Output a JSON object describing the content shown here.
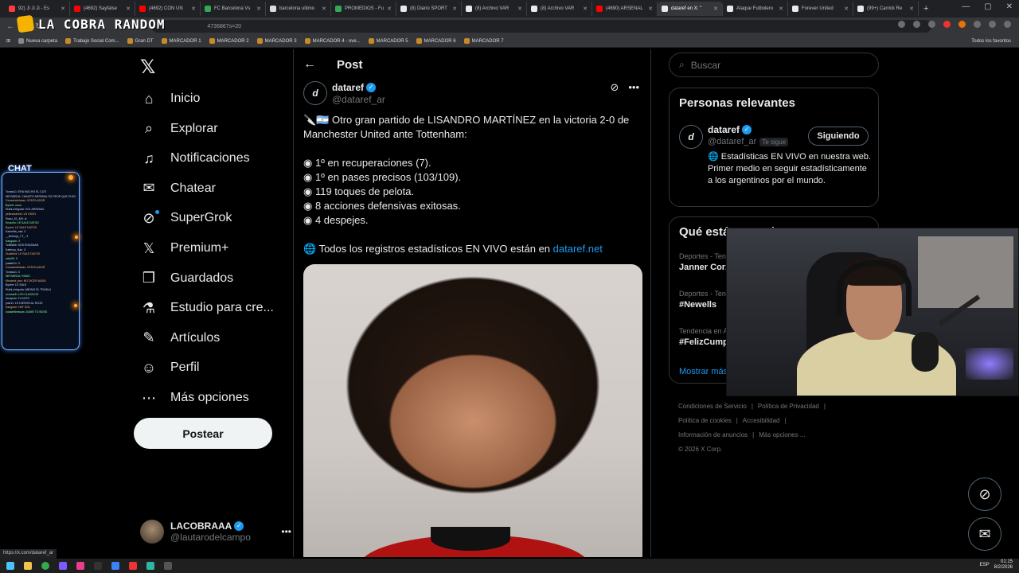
{
  "browser": {
    "tabs": [
      {
        "label": "92) Ji Ji Ji - Es",
        "color": "#ff3b3b"
      },
      {
        "label": "(4692) Sayfalse",
        "color": "#ff0000"
      },
      {
        "label": "(4692) CON UN",
        "color": "#ff0000"
      },
      {
        "label": "FC Barcelona Vs",
        "color": "#34a853"
      },
      {
        "label": "barcelona ultimo",
        "color": "#dadce0"
      },
      {
        "label": "PROMEDIOS - Fu",
        "color": "#34a853"
      },
      {
        "label": "(8) Diario SPORT",
        "color": "#e7e9ea"
      },
      {
        "label": "(8) Archivo VAR",
        "color": "#e7e9ea"
      },
      {
        "label": "(8) Archivo VAR",
        "color": "#e7e9ea"
      },
      {
        "label": "(4690) ARSENAL",
        "color": "#ff0000"
      },
      {
        "label": "dataref en X: \"",
        "color": "#e7e9ea",
        "active": true
      },
      {
        "label": "Ataque Futbolero",
        "color": "#e7e9ea"
      },
      {
        "label": "Forever United",
        "color": "#e7e9ea"
      },
      {
        "label": "(99+) Carrick Re",
        "color": "#e7e9ea"
      }
    ],
    "url_fragment": "4736867s=20",
    "bookmarks": [
      {
        "label": "Nueva carpeta",
        "folder": true
      },
      {
        "label": "Trabajo Social Com...",
        "folder": false
      },
      {
        "label": "Gran DT",
        "folder": false
      },
      {
        "label": "MARCADOR 1",
        "folder": false
      },
      {
        "label": "MARCADOR 2",
        "folder": false
      },
      {
        "label": "MARCADOR 3",
        "folder": false
      },
      {
        "label": "MARCADOR 4 - ove...",
        "folder": false
      },
      {
        "label": "MARCADOR 5",
        "folder": false
      },
      {
        "label": "MARCADOR 6",
        "folder": false
      },
      {
        "label": "MARCADOR 7",
        "folder": false
      }
    ],
    "all_favorites": "Todos los favoritos",
    "status_link": "https://x.com/dataref_ar"
  },
  "overlay": {
    "brand": "LA COBRA RANDOM",
    "chat_title": "CHAT",
    "chat_lines": [
      "Tomas11: ERA MUCHO EL CUTI",
      "NEYMIEDA: CHAKITO ARSENAL ES PEOR QUE CHICHITO",
      "Gonzalodelavac: VENTILADOR",
      "Bynert: uuuu",
      "RuthLaYeguita: VOL ARSENAL",
      "yellowsolvelo: LN OSSO",
      "Franz_01_MX: si",
      "Kruscho: LE SALE DATOS",
      "Bynert: LE SALE DATOS",
      "Kamelita_mia: 3",
      "__Burbuja_YT_: 3",
      "Kaoguan: 3",
      "ToNBI65: NOS ENGANAN",
      "Kafenoy_Nac: 3",
      "Dudderia: LE SALE DATOS",
      "roba30: 3",
      "joaakir11: 3",
      "Gonzalodelavac: VENTILADOR",
      "Tomas11: 3",
      "NEYMIEDA: RISAS",
      "Mordeck_tiez: NO DICEN NADA",
      "Bynert: LE SALE",
      "RuthLaYeguita: ABONO EL TRUBLA",
      "sorocar8: LOS CLASICOS",
      "Amapolo: FLOJITO",
      "jose11: LE DIERON AL ROJO",
      "Kaoguan: HAY GOL",
      "lucasfelinescas: DAME TO BOSS"
    ]
  },
  "nav": {
    "items": [
      {
        "name": "inicio",
        "label": "Inicio",
        "icon": "home-icon"
      },
      {
        "name": "explorar",
        "label": "Explorar",
        "icon": "search-icon"
      },
      {
        "name": "notificaciones",
        "label": "Notificaciones",
        "icon": "bell-icon"
      },
      {
        "name": "chatear",
        "label": "Chatear",
        "icon": "mail-icon"
      },
      {
        "name": "supergrok",
        "label": "SuperGrok",
        "icon": "grok-icon"
      },
      {
        "name": "premium",
        "label": "Premium+",
        "icon": "x-icon"
      },
      {
        "name": "guardados",
        "label": "Guardados",
        "icon": "bookmark-icon"
      },
      {
        "name": "estudio",
        "label": "Estudio para cre...",
        "icon": "flask-icon"
      },
      {
        "name": "articulos",
        "label": "Artículos",
        "icon": "article-icon"
      },
      {
        "name": "perfil",
        "label": "Perfil",
        "icon": "person-icon"
      },
      {
        "name": "mas-opciones",
        "label": "Más opciones",
        "icon": "more-circle-icon"
      }
    ],
    "post_button": "Postear",
    "account": {
      "name": "LACOBRAAA",
      "handle": "@lautarodelcampo"
    }
  },
  "post": {
    "header": "Post",
    "author": {
      "name": "dataref",
      "handle": "@dataref_ar"
    },
    "intro": "🔪🇦🇷 Otro gran partido de LISANDRO MARTÍNEZ en la victoria 2-0 de Manchester United ante Tottenham:",
    "stats": [
      "◉ 1º en recuperaciones (7).",
      "◉ 1º en pases precisos (103/109).",
      "◉ 119 toques de pelota.",
      "◉ 8 acciones defensivas exitosas.",
      "◉ 4 despejes."
    ],
    "footer_text": "🌐 Todos los registros estadísticos EN VIVO están en ",
    "footer_link": "dataref.net"
  },
  "sidebar": {
    "search_placeholder": "Buscar",
    "relevant_title": "Personas relevantes",
    "relevant": {
      "name": "dataref",
      "handle": "@dataref_ar",
      "follows_you": "Te sigue",
      "button": "Siguiendo",
      "bio": "🌐 Estadísticas EN VIVO en nuestra web. Primer medio en seguir estadísticamente a los argentinos por el mundo."
    },
    "trends_title": "Qué está pasando",
    "trends": [
      {
        "category": "Deportes - Tendencia",
        "name": "Janner Corzo"
      },
      {
        "category": "Deportes - Tendencia",
        "name": "#Newells"
      },
      {
        "category": "Tendencia en Argentina",
        "name": "#FelizCumple"
      }
    ],
    "show_more": "Mostrar más",
    "footer_links": [
      "Condiciones de Servicio",
      "Política de Privacidad",
      "Política de cookies",
      "Accesibilidad",
      "Información de anuncios",
      "Más opciones ..."
    ],
    "copyright": "© 2026 X Corp."
  },
  "system": {
    "language": "ESP",
    "time": "01:15",
    "date": "8/2/2026"
  }
}
